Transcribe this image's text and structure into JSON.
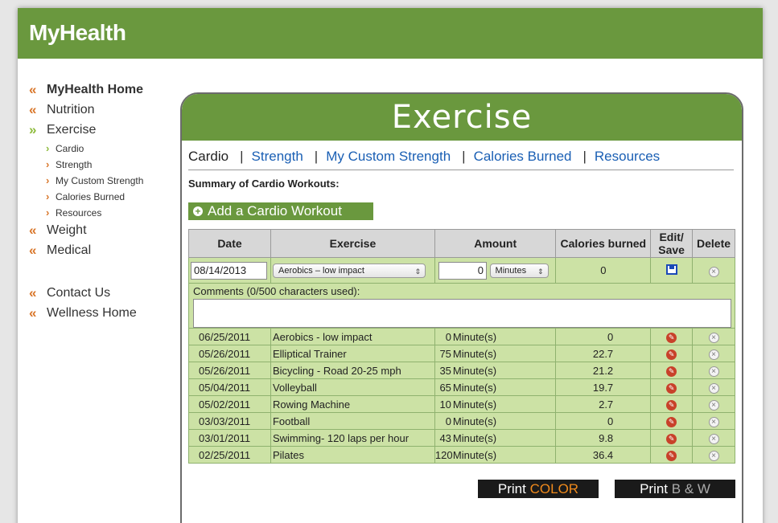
{
  "app": {
    "brand": "MyHealth"
  },
  "sidebar": {
    "items": [
      {
        "label": "MyHealth Home"
      },
      {
        "label": "Nutrition"
      },
      {
        "label": "Exercise"
      },
      {
        "label": "Weight"
      },
      {
        "label": "Medical"
      }
    ],
    "sub_items": [
      {
        "label": "Cardio"
      },
      {
        "label": "Strength"
      },
      {
        "label": "My Custom Strength"
      },
      {
        "label": "Calories Burned"
      },
      {
        "label": "Resources"
      }
    ],
    "bottom_items": [
      {
        "label": "Contact Us"
      },
      {
        "label": "Wellness Home"
      }
    ],
    "chevron_glyph": "«",
    "active_chevron_glyph": "»",
    "sub_chevron_glyph": "›"
  },
  "panel": {
    "title": "Exercise",
    "tabs": [
      {
        "label": "Cardio"
      },
      {
        "label": "Strength"
      },
      {
        "label": "My Custom Strength"
      },
      {
        "label": "Calories Burned"
      },
      {
        "label": "Resources"
      }
    ],
    "tab_separator": "|",
    "summary_label": "Summary of Cardio Workouts:",
    "add_button": {
      "label": "Add a Cardio Workout",
      "icon": "plus-circle-icon"
    }
  },
  "table": {
    "headers": {
      "date": "Date",
      "exercise": "Exercise",
      "amount": "Amount",
      "calories": "Calories burned",
      "edit_save_line1": "Edit/",
      "edit_save_line2": "Save",
      "delete": "Delete"
    },
    "new_entry": {
      "date": "08/14/2013",
      "exercise": "Aerobics – low impact",
      "amount": "0",
      "unit": "Minutes",
      "calories": "0",
      "comments_label": "Comments (0/500 characters used):",
      "comments_value": ""
    },
    "rows": [
      {
        "date": "06/25/2011",
        "exercise": "Aerobics - low impact",
        "amount": "0",
        "unit": "Minute(s)",
        "calories": "0"
      },
      {
        "date": "05/26/2011",
        "exercise": "Elliptical Trainer",
        "amount": "75",
        "unit": "Minute(s)",
        "calories": "22.7"
      },
      {
        "date": "05/26/2011",
        "exercise": "Bicycling - Road 20-25 mph",
        "amount": "35",
        "unit": "Minute(s)",
        "calories": "21.2"
      },
      {
        "date": "05/04/2011",
        "exercise": "Volleyball",
        "amount": "65",
        "unit": "Minute(s)",
        "calories": "19.7"
      },
      {
        "date": "05/02/2011",
        "exercise": "Rowing Machine",
        "amount": "10",
        "unit": "Minute(s)",
        "calories": "2.7"
      },
      {
        "date": "03/03/2011",
        "exercise": "Football",
        "amount": "0",
        "unit": "Minute(s)",
        "calories": "0"
      },
      {
        "date": "03/01/2011",
        "exercise": "Swimming- 120 laps per hour",
        "amount": "43",
        "unit": "Minute(s)",
        "calories": "9.8"
      },
      {
        "date": "02/25/2011",
        "exercise": "Pilates",
        "amount": "120",
        "unit": "Minute(s)",
        "calories": "36.4"
      }
    ]
  },
  "print": {
    "color": {
      "prefix": "Print",
      "accent": "COLOR"
    },
    "bw": {
      "prefix": "Print",
      "accent": "B & W"
    }
  },
  "colors": {
    "brand_green": "#6a983e",
    "row_green": "#cce2a5",
    "chevron_orange": "#d9772b",
    "chevron_green": "#8dbb3c",
    "link_blue": "#1a5fb4",
    "print_accent": "#f08a1c"
  }
}
